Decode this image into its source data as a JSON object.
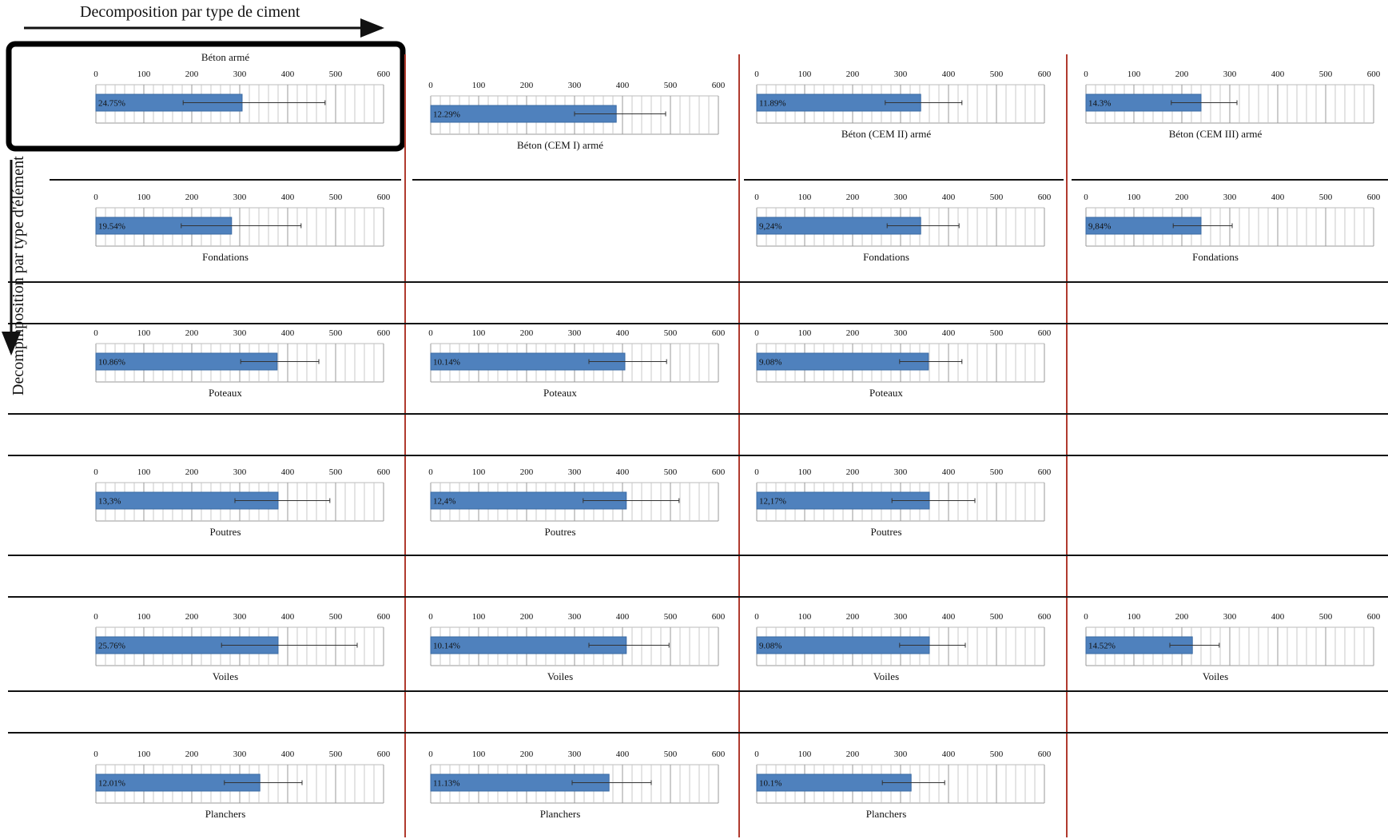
{
  "col_header": "Decomposition par type de ciment",
  "row_header": "Decompmposition par type d'élément",
  "colors": {
    "bar": "#4f81bd",
    "bar_edge": "#3a6aa3",
    "grid": "#c8c8c8",
    "divider_red": "#b03a2e",
    "divider_black": "#111111"
  },
  "axis_ticks": [
    "0",
    "100",
    "200",
    "300",
    "400",
    "500",
    "600"
  ],
  "chart_data": [
    {
      "type": "bar",
      "orientation": "horizontal",
      "col": 0,
      "row": 0,
      "title": "Béton armé",
      "title_pos": "top",
      "xlim": [
        0,
        600
      ],
      "value": 305,
      "error_low": 182,
      "error_high": 478,
      "label": "24.75%",
      "grid": true
    },
    {
      "type": "bar",
      "orientation": "horizontal",
      "col": 1,
      "row": 0,
      "title": "Béton (CEM I) armé",
      "title_pos": "bottom",
      "xlim": [
        0,
        600
      ],
      "value": 387,
      "error_low": 300,
      "error_high": 490,
      "label": "12.29%",
      "grid": true
    },
    {
      "type": "bar",
      "orientation": "horizontal",
      "col": 2,
      "row": 0,
      "title": "Béton (CEM II) armé",
      "title_pos": "bottom",
      "xlim": [
        0,
        600
      ],
      "value": 342,
      "error_low": 268,
      "error_high": 428,
      "label": "11.89%",
      "grid": true
    },
    {
      "type": "bar",
      "orientation": "horizontal",
      "col": 3,
      "row": 0,
      "title": "Béton (CEM III) armé",
      "title_pos": "bottom",
      "xlim": [
        0,
        600
      ],
      "value": 240,
      "error_low": 178,
      "error_high": 315,
      "label": "14.3%",
      "grid": true
    },
    {
      "type": "bar",
      "orientation": "horizontal",
      "col": 0,
      "row": 1,
      "title": "Fondations",
      "title_pos": "bottom",
      "xlim": [
        0,
        600
      ],
      "value": 283,
      "error_low": 178,
      "error_high": 428,
      "label": "19.54%",
      "grid": true
    },
    {
      "type": "bar",
      "orientation": "horizontal",
      "col": 2,
      "row": 1,
      "title": "Fondations",
      "title_pos": "bottom",
      "xlim": [
        0,
        600
      ],
      "value": 342,
      "error_low": 272,
      "error_high": 422,
      "label": "9,24%",
      "grid": true
    },
    {
      "type": "bar",
      "orientation": "horizontal",
      "col": 3,
      "row": 1,
      "title": "Fondations",
      "title_pos": "bottom",
      "xlim": [
        0,
        600
      ],
      "value": 240,
      "error_low": 182,
      "error_high": 305,
      "label": "9,84%",
      "grid": true
    },
    {
      "type": "bar",
      "orientation": "horizontal",
      "col": 0,
      "row": 2,
      "title": "Poteaux",
      "title_pos": "bottom",
      "xlim": [
        0,
        600
      ],
      "value": 378,
      "error_low": 302,
      "error_high": 465,
      "label": "10.86%",
      "grid": true
    },
    {
      "type": "bar",
      "orientation": "horizontal",
      "col": 1,
      "row": 2,
      "title": "Poteaux",
      "title_pos": "bottom",
      "xlim": [
        0,
        600
      ],
      "value": 405,
      "error_low": 330,
      "error_high": 492,
      "label": "10.14%",
      "grid": true
    },
    {
      "type": "bar",
      "orientation": "horizontal",
      "col": 2,
      "row": 2,
      "title": "Poteaux",
      "title_pos": "bottom",
      "xlim": [
        0,
        600
      ],
      "value": 358,
      "error_low": 298,
      "error_high": 428,
      "label": "9.08%",
      "grid": true
    },
    {
      "type": "bar",
      "orientation": "horizontal",
      "col": 0,
      "row": 3,
      "title": "Poutres",
      "title_pos": "bottom",
      "xlim": [
        0,
        600
      ],
      "value": 380,
      "error_low": 290,
      "error_high": 488,
      "label": "13,3%",
      "grid": true
    },
    {
      "type": "bar",
      "orientation": "horizontal",
      "col": 1,
      "row": 3,
      "title": "Poutres",
      "title_pos": "bottom",
      "xlim": [
        0,
        600
      ],
      "value": 408,
      "error_low": 318,
      "error_high": 518,
      "label": "12,4%",
      "grid": true
    },
    {
      "type": "bar",
      "orientation": "horizontal",
      "col": 2,
      "row": 3,
      "title": "Poutres",
      "title_pos": "bottom",
      "xlim": [
        0,
        600
      ],
      "value": 360,
      "error_low": 282,
      "error_high": 455,
      "label": "12,17%",
      "grid": true
    },
    {
      "type": "bar",
      "orientation": "horizontal",
      "col": 0,
      "row": 4,
      "title": "Voiles",
      "title_pos": "bottom",
      "xlim": [
        0,
        600
      ],
      "value": 380,
      "error_low": 262,
      "error_high": 545,
      "label": "25.76%",
      "grid": true
    },
    {
      "type": "bar",
      "orientation": "horizontal",
      "col": 1,
      "row": 4,
      "title": "Voiles",
      "title_pos": "bottom",
      "xlim": [
        0,
        600
      ],
      "value": 408,
      "error_low": 330,
      "error_high": 497,
      "label": "10.14%",
      "grid": true
    },
    {
      "type": "bar",
      "orientation": "horizontal",
      "col": 2,
      "row": 4,
      "title": "Voiles",
      "title_pos": "bottom",
      "xlim": [
        0,
        600
      ],
      "value": 360,
      "error_low": 298,
      "error_high": 435,
      "label": "9.08%",
      "grid": true
    },
    {
      "type": "bar",
      "orientation": "horizontal",
      "col": 3,
      "row": 4,
      "title": "Voiles",
      "title_pos": "bottom",
      "xlim": [
        0,
        600
      ],
      "value": 222,
      "error_low": 175,
      "error_high": 278,
      "label": "14.52%",
      "grid": true
    },
    {
      "type": "bar",
      "orientation": "horizontal",
      "col": 0,
      "row": 5,
      "title": "Planchers",
      "title_pos": "bottom",
      "xlim": [
        0,
        600
      ],
      "value": 342,
      "error_low": 268,
      "error_high": 430,
      "label": "12.01%",
      "grid": true
    },
    {
      "type": "bar",
      "orientation": "horizontal",
      "col": 1,
      "row": 5,
      "title": "Planchers",
      "title_pos": "bottom",
      "xlim": [
        0,
        600
      ],
      "value": 372,
      "error_low": 295,
      "error_high": 460,
      "label": "11.13%",
      "grid": true
    },
    {
      "type": "bar",
      "orientation": "horizontal",
      "col": 2,
      "row": 5,
      "title": "Planchers",
      "title_pos": "bottom",
      "xlim": [
        0,
        600
      ],
      "value": 322,
      "error_low": 262,
      "error_high": 392,
      "label": "10.1%",
      "grid": true
    }
  ]
}
